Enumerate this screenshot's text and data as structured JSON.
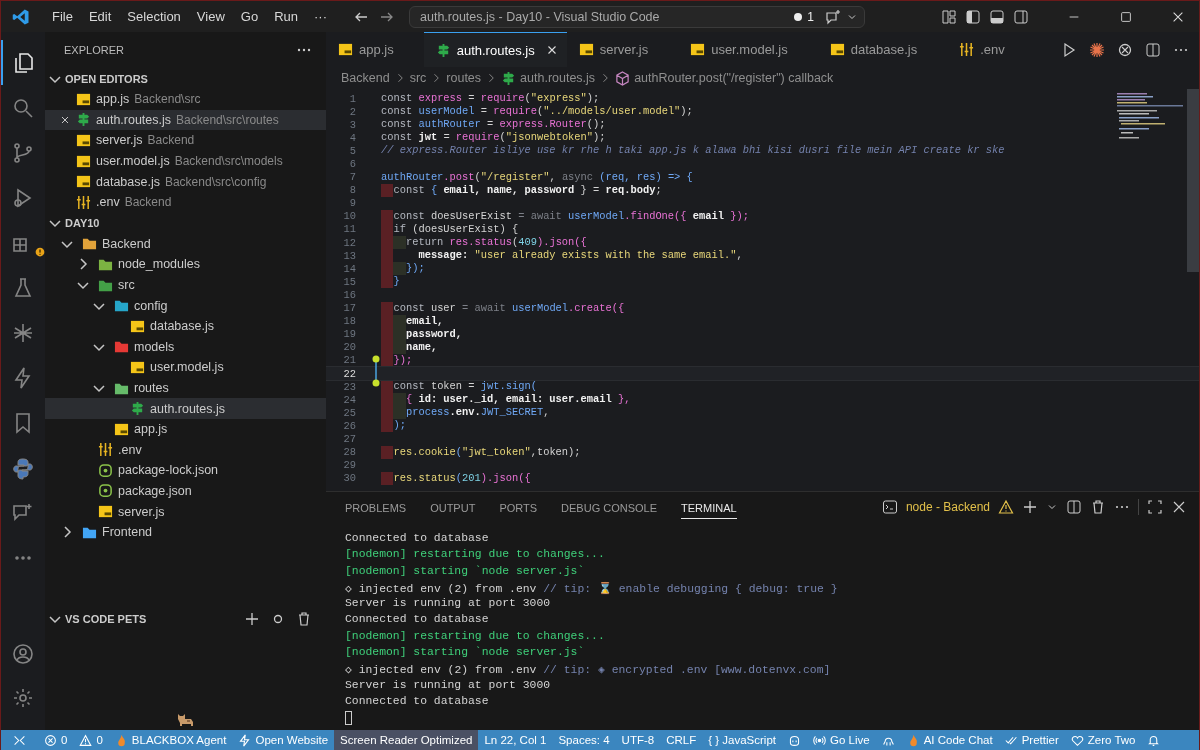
{
  "title_bar": {
    "menu": [
      "File",
      "Edit",
      "Selection",
      "View",
      "Go",
      "Run",
      "···"
    ],
    "command_center": "auth.routes.js - Day10 - Visual Studio Code",
    "badge": "1"
  },
  "activity_bar": [
    {
      "kind": "files",
      "selected": true
    },
    {
      "kind": "search",
      "selected": false
    },
    {
      "kind": "source-control",
      "selected": false
    },
    {
      "kind": "debug",
      "selected": false
    },
    {
      "kind": "extensions",
      "selected": false
    },
    {
      "kind": "flask",
      "selected": false
    },
    {
      "kind": "asterisk",
      "selected": false
    },
    {
      "kind": "bolt",
      "selected": false
    },
    {
      "kind": "bookmark",
      "selected": false
    },
    {
      "kind": "python",
      "selected": false
    },
    {
      "kind": "chat",
      "selected": false
    },
    {
      "kind": "more",
      "selected": false
    }
  ],
  "explorer": {
    "title": "EXPLORER",
    "open_editors": {
      "title": "OPEN EDITORS",
      "items": [
        {
          "name": "app.js",
          "path": "Backend\\src",
          "kind": "js",
          "selected": false
        },
        {
          "name": "auth.routes.js",
          "path": "Backend\\src\\routes",
          "kind": "routes",
          "selected": true
        },
        {
          "name": "server.js",
          "path": "Backend",
          "kind": "js",
          "selected": false
        },
        {
          "name": "user.model.js",
          "path": "Backend\\src\\models",
          "kind": "js",
          "selected": false
        },
        {
          "name": "database.js",
          "path": "Backend\\src\\config",
          "kind": "js",
          "selected": false
        },
        {
          "name": ".env",
          "path": "Backend",
          "kind": "env",
          "selected": false
        }
      ]
    },
    "workspace": {
      "title": "DAY10",
      "tree": [
        {
          "name": "Backend",
          "kind": "folder",
          "color": "#e0a23a",
          "expanded": true,
          "selected": false,
          "children": [
            {
              "name": "node_modules",
              "kind": "folder",
              "color": "#7cb342",
              "expanded": false,
              "selected": false
            },
            {
              "name": "src",
              "kind": "folder",
              "color": "#43a047",
              "expanded": true,
              "selected": false,
              "children": [
                {
                  "name": "config",
                  "kind": "folder",
                  "color": "#26a6c9",
                  "expanded": true,
                  "selected": false,
                  "children": [
                    {
                      "name": "database.js",
                      "kind": "js",
                      "selected": false
                    }
                  ]
                },
                {
                  "name": "models",
                  "kind": "folder",
                  "color": "#e53935",
                  "expanded": true,
                  "selected": false,
                  "children": [
                    {
                      "name": "user.model.js",
                      "kind": "js",
                      "selected": false
                    }
                  ]
                },
                {
                  "name": "routes",
                  "kind": "folder",
                  "color": "#66bb6a",
                  "expanded": true,
                  "selected": false,
                  "children": [
                    {
                      "name": "auth.routes.js",
                      "kind": "routes",
                      "selected": true
                    }
                  ]
                },
                {
                  "name": "app.js",
                  "kind": "js",
                  "selected": false
                }
              ]
            },
            {
              "name": ".env",
              "kind": "env",
              "selected": false
            },
            {
              "name": "package-lock.json",
              "kind": "json",
              "selected": false
            },
            {
              "name": "package.json",
              "kind": "json",
              "selected": false
            },
            {
              "name": "server.js",
              "kind": "js",
              "selected": false
            }
          ]
        },
        {
          "name": "Frontend",
          "kind": "folder",
          "color": "#42a5f5",
          "expanded": false,
          "selected": false
        }
      ]
    },
    "pets": {
      "title": "VS CODE PETS"
    }
  },
  "tabs": [
    {
      "label": "app.js",
      "kind": "js",
      "selected": false
    },
    {
      "label": "auth.routes.js",
      "kind": "routes",
      "selected": true
    },
    {
      "label": "server.js",
      "kind": "js",
      "selected": false
    },
    {
      "label": "user.model.js",
      "kind": "js",
      "selected": false
    },
    {
      "label": "database.js",
      "kind": "js",
      "selected": false
    },
    {
      "label": ".env",
      "kind": "env",
      "selected": false
    }
  ],
  "breadcrumb": [
    {
      "label": "Backend",
      "kind": "folder"
    },
    {
      "label": "src",
      "kind": "folder"
    },
    {
      "label": "routes",
      "kind": "folder"
    },
    {
      "label": "auth.routes.js",
      "kind": "routes"
    },
    {
      "label": "authRouter.post(\"/register\") callback",
      "kind": "method"
    }
  ],
  "code": [
    {
      "n": "1",
      "tokens": [
        {
          "text": "const ",
          "kind": "keyword"
        },
        {
          "text": "express",
          "kind": "func"
        },
        {
          "text": " = ",
          "kind": "plain"
        },
        {
          "text": "require",
          "kind": "func"
        },
        {
          "text": "(",
          "kind": "plain"
        },
        {
          "text": "\"express\"",
          "kind": "string"
        },
        {
          "text": ");",
          "kind": "plain"
        }
      ]
    },
    {
      "n": "2",
      "tokens": [
        {
          "text": "const ",
          "kind": "keyword"
        },
        {
          "text": "userModel",
          "kind": "ident"
        },
        {
          "text": " = ",
          "kind": "plain"
        },
        {
          "text": "require",
          "kind": "func"
        },
        {
          "text": "(",
          "kind": "plain"
        },
        {
          "text": "\"../models/user.model\"",
          "kind": "string"
        },
        {
          "text": ");",
          "kind": "plain"
        }
      ]
    },
    {
      "n": "3",
      "tokens": [
        {
          "text": "const ",
          "kind": "keyword"
        },
        {
          "text": "authRouter",
          "kind": "ident"
        },
        {
          "text": " = ",
          "kind": "plain"
        },
        {
          "text": "express.Router",
          "kind": "func"
        },
        {
          "text": "();",
          "kind": "plain"
        }
      ]
    },
    {
      "n": "4",
      "tokens": [
        {
          "text": "const ",
          "kind": "keyword"
        },
        {
          "text": "jwt",
          "kind": "prop"
        },
        {
          "text": " = ",
          "kind": "plain"
        },
        {
          "text": "require",
          "kind": "func"
        },
        {
          "text": "(",
          "kind": "plain"
        },
        {
          "text": "\"jsonwebtoken\"",
          "kind": "string"
        },
        {
          "text": ");",
          "kind": "plain"
        }
      ]
    },
    {
      "n": "5",
      "tokens": [
        {
          "text": "// express.Router isliye use kr rhe h taki app.js k alawa bhi kisi dusri file mein API create kr ske",
          "kind": "comment"
        }
      ]
    },
    {
      "n": "6"
    },
    {
      "n": "7",
      "tokens": [
        {
          "text": "authRouter",
          "kind": "ident"
        },
        {
          "text": ".post",
          "kind": "func"
        },
        {
          "text": "(",
          "kind": "plain"
        },
        {
          "text": "\"/register\"",
          "kind": "string"
        },
        {
          "text": ", ",
          "kind": "plain"
        },
        {
          "text": "async ",
          "kind": "muted"
        },
        {
          "text": "(req, res) => {",
          "kind": "ident"
        }
      ]
    },
    {
      "n": "8",
      "kind": "error-indent",
      "tokens": [
        {
          "text": "  const ",
          "kind": "keyword"
        },
        {
          "text": "{ ",
          "kind": "ident"
        },
        {
          "text": "email, name, password",
          "kind": "prop"
        },
        {
          "text": " } = ",
          "kind": "plain"
        },
        {
          "text": "req.body",
          "kind": "prop"
        },
        {
          "text": ";",
          "kind": "plain"
        }
      ]
    },
    {
      "n": "9"
    },
    {
      "n": "10",
      "kind": "error-indent",
      "tokens": [
        {
          "text": "  const ",
          "kind": "keyword"
        },
        {
          "text": "doesUserExist",
          "kind": "plain"
        },
        {
          "text": " = await ",
          "kind": "muted"
        },
        {
          "text": "userModel",
          "kind": "ident"
        },
        {
          "text": ".findOne",
          "kind": "func"
        },
        {
          "text": "({ ",
          "kind": "func"
        },
        {
          "text": "email",
          "kind": "prop"
        },
        {
          "text": " });",
          "kind": "func"
        }
      ]
    },
    {
      "n": "11",
      "kind": "error-indent",
      "tokens": [
        {
          "text": "  if ",
          "kind": "keyword"
        },
        {
          "text": "(doesUserExist) {",
          "kind": "plain"
        }
      ]
    },
    {
      "n": "12",
      "kind": "nested-indent",
      "tokens": [
        {
          "text": "    return ",
          "kind": "keyword"
        },
        {
          "text": "res.status",
          "kind": "func"
        },
        {
          "text": "(",
          "kind": "plain"
        },
        {
          "text": "409",
          "kind": "number"
        },
        {
          "text": ").json({",
          "kind": "func"
        }
      ]
    },
    {
      "n": "13",
      "kind": "error-indent",
      "tokens": [
        {
          "text": "      message: ",
          "kind": "prop"
        },
        {
          "text": "\"user already exists with the same email.\"",
          "kind": "string"
        },
        {
          "text": ",",
          "kind": "plain"
        }
      ]
    },
    {
      "n": "14",
      "kind": "nested-indent",
      "tokens": [
        {
          "text": "    });",
          "kind": "ident"
        }
      ]
    },
    {
      "n": "15",
      "kind": "error-indent",
      "tokens": [
        {
          "text": "  }",
          "kind": "ident"
        }
      ]
    },
    {
      "n": "16"
    },
    {
      "n": "17",
      "kind": "error-indent",
      "tokens": [
        {
          "text": "  const ",
          "kind": "keyword"
        },
        {
          "text": "user",
          "kind": "plain"
        },
        {
          "text": " = await ",
          "kind": "muted"
        },
        {
          "text": "userModel",
          "kind": "ident"
        },
        {
          "text": ".create({",
          "kind": "func"
        }
      ]
    },
    {
      "n": "18",
      "kind": "nested-indent",
      "tokens": [
        {
          "text": "    email,",
          "kind": "prop"
        }
      ]
    },
    {
      "n": "19",
      "kind": "nested-indent",
      "tokens": [
        {
          "text": "    password,",
          "kind": "prop"
        }
      ]
    },
    {
      "n": "20",
      "kind": "nested-indent",
      "tokens": [
        {
          "text": "    name,",
          "kind": "prop"
        }
      ]
    },
    {
      "n": "21",
      "kind": "error-indent",
      "marker": true,
      "tokens": [
        {
          "text": "  });",
          "kind": "func"
        }
      ]
    },
    {
      "n": "22",
      "current": true
    },
    {
      "n": "23",
      "kind": "error-indent",
      "tokens": [
        {
          "text": "  const ",
          "kind": "keyword"
        },
        {
          "text": "token",
          "kind": "plain"
        },
        {
          "text": " = ",
          "kind": "plain"
        },
        {
          "text": "jwt.sign(",
          "kind": "ident"
        }
      ]
    },
    {
      "n": "24",
      "kind": "nested-indent",
      "tokens": [
        {
          "text": "    { ",
          "kind": "func"
        },
        {
          "text": "id: user._id, email: user.email",
          "kind": "prop"
        },
        {
          "text": " },",
          "kind": "func"
        }
      ]
    },
    {
      "n": "25",
      "kind": "nested-indent",
      "tokens": [
        {
          "text": "    process",
          "kind": "ident"
        },
        {
          "text": ".env.",
          "kind": "prop"
        },
        {
          "text": "JWT_SECRET",
          "kind": "ident"
        },
        {
          "text": ",",
          "kind": "plain"
        }
      ]
    },
    {
      "n": "26",
      "kind": "error-indent",
      "tokens": [
        {
          "text": "  );",
          "kind": "ident"
        }
      ]
    },
    {
      "n": "27"
    },
    {
      "n": "28",
      "kind": "error-indent",
      "tokens": [
        {
          "text": "  res.cookie",
          "kind": "string"
        },
        {
          "text": "(",
          "kind": "ident"
        },
        {
          "text": "\"jwt_token\"",
          "kind": "string"
        },
        {
          "text": ",token);",
          "kind": "plain"
        }
      ]
    },
    {
      "n": "29"
    },
    {
      "n": "30",
      "kind": "error-indent",
      "tokens": [
        {
          "text": "  res.status",
          "kind": "string"
        },
        {
          "text": "(",
          "kind": "ident"
        },
        {
          "text": "201",
          "kind": "number"
        },
        {
          "text": ").json({",
          "kind": "func"
        }
      ]
    }
  ],
  "panel": {
    "tabs": [
      {
        "label": "PROBLEMS",
        "selected": false
      },
      {
        "label": "OUTPUT",
        "selected": false
      },
      {
        "label": "PORTS",
        "selected": false
      },
      {
        "label": "DEBUG CONSOLE",
        "selected": false
      },
      {
        "label": "TERMINAL",
        "selected": true
      }
    ],
    "terminal_name": "node - Backend",
    "lines": [
      [
        {
          "text": "Connected to database",
          "kind": "plain"
        }
      ],
      [
        {
          "text": "[nodemon] restarting due to changes...",
          "kind": "green"
        }
      ],
      [
        {
          "text": "[nodemon] starting `node server.js`",
          "kind": "green"
        }
      ],
      [
        {
          "text": "◇ injected env (2) from .env ",
          "kind": "plain"
        },
        {
          "text": "// tip: ⌛ enable debugging { debug: true }",
          "kind": "comment"
        }
      ],
      [
        {
          "text": "Server is running at port 3000",
          "kind": "plain"
        }
      ],
      [
        {
          "text": "Connected to database",
          "kind": "plain"
        }
      ],
      [
        {
          "text": "[nodemon] restarting due to changes...",
          "kind": "green"
        }
      ],
      [
        {
          "text": "[nodemon] starting `node server.js`",
          "kind": "green"
        }
      ],
      [
        {
          "text": "◇ injected env (2) from .env ",
          "kind": "plain"
        },
        {
          "text": "// tip: ◈ encrypted .env [www.dotenvx.com]",
          "kind": "comment"
        }
      ],
      [
        {
          "text": "Server is running at port 3000",
          "kind": "plain"
        }
      ],
      [
        {
          "text": "Connected to database",
          "kind": "plain"
        }
      ]
    ]
  },
  "status_bar": [
    {
      "kind": "remote",
      "highlighted": false
    },
    {
      "kind": "error",
      "label": "0",
      "highlighted": false
    },
    {
      "kind": "warning",
      "label": "0",
      "highlighted": false
    },
    {
      "kind": "flame",
      "label": "BLACKBOX Agent",
      "highlighted": false
    },
    {
      "kind": "bolt",
      "label": "Open Website",
      "highlighted": false
    },
    {
      "kind": "text",
      "label": "Screen Reader Optimized",
      "highlighted": true
    },
    {
      "kind": "text",
      "label": "Ln 22, Col 1",
      "highlighted": false
    },
    {
      "kind": "text",
      "label": "Spaces: 4",
      "highlighted": false
    },
    {
      "kind": "text",
      "label": "UTF-8",
      "highlighted": false
    },
    {
      "kind": "text",
      "label": "CRLF",
      "highlighted": false
    },
    {
      "kind": "text",
      "label": "{ } JavaScript",
      "highlighted": false
    },
    {
      "kind": "copilot",
      "highlighted": false
    },
    {
      "kind": "broadcast",
      "label": "Go Live",
      "highlighted": false
    },
    {
      "kind": "octopus",
      "highlighted": false
    },
    {
      "kind": "flame",
      "label": "AI Code Chat",
      "highlighted": false
    },
    {
      "kind": "checks",
      "label": "Prettier",
      "highlighted": false
    },
    {
      "kind": "heart",
      "label": "Zero Two",
      "highlighted": false
    },
    {
      "kind": "bell",
      "highlighted": false
    }
  ]
}
